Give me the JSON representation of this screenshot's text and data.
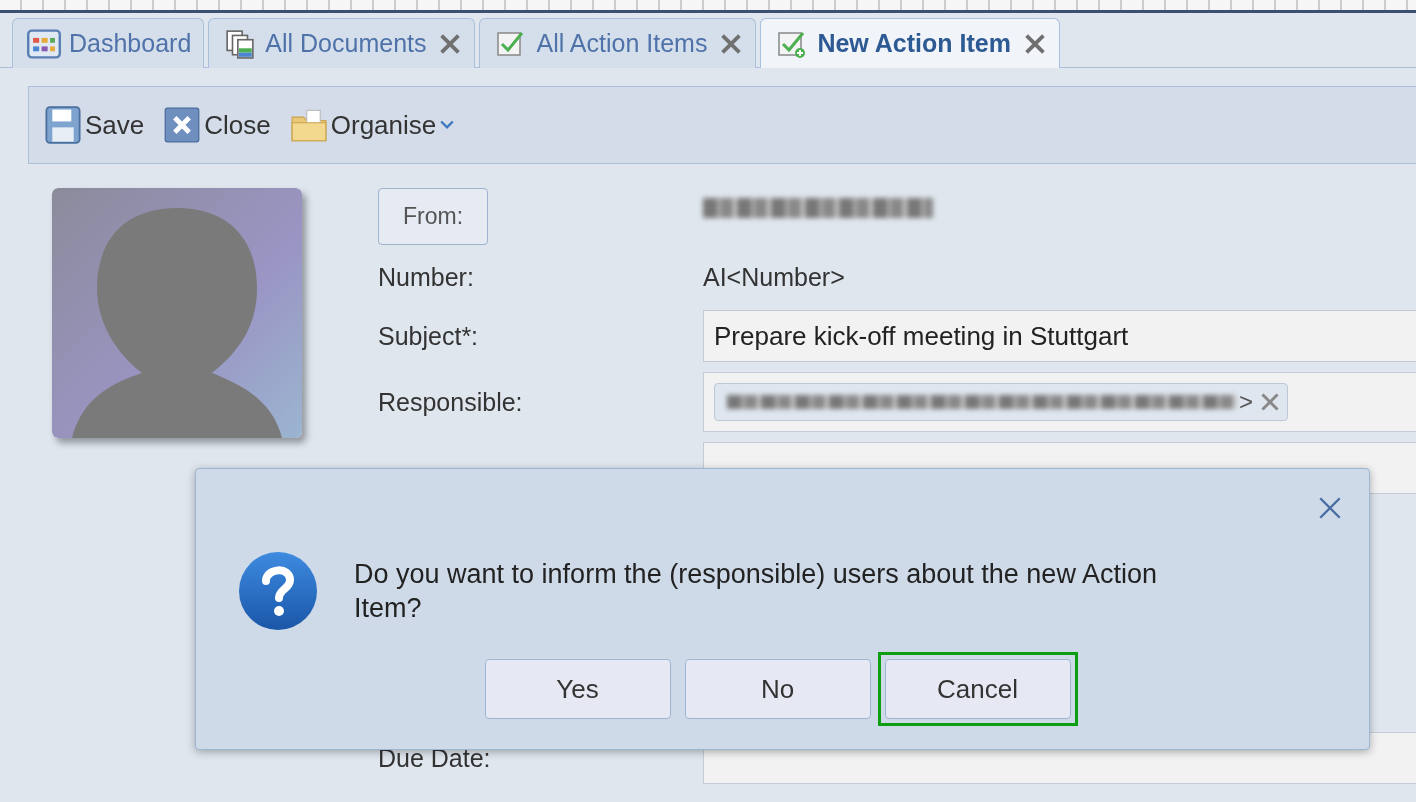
{
  "tabs": [
    {
      "label": "Dashboard",
      "kind": "dashboard",
      "closable": false,
      "selected": false
    },
    {
      "label": "All Documents",
      "kind": "documents",
      "closable": true,
      "selected": false
    },
    {
      "label": "All Action Items",
      "kind": "list",
      "closable": true,
      "selected": false
    },
    {
      "label": "New Action Item",
      "kind": "new",
      "closable": true,
      "selected": true
    }
  ],
  "toolbar": [
    {
      "label": "Save",
      "kind": "save",
      "dropdown": false
    },
    {
      "label": "Close",
      "kind": "close",
      "dropdown": false
    },
    {
      "label": "Organise",
      "kind": "organise",
      "dropdown": true
    }
  ],
  "form": {
    "from_button": "From:",
    "rows": [
      {
        "label": "Number:",
        "kind": "text",
        "value": "AI<Number>"
      },
      {
        "label": "Subject*:",
        "kind": "input",
        "value": "Prepare kick-off meeting in Stuttgart"
      },
      {
        "label": "Responsible:",
        "kind": "chips",
        "chip_suffix": ">"
      },
      {
        "kind": "input",
        "value": ""
      }
    ],
    "due_date_label": "Due Date:"
  },
  "dialog": {
    "message": "Do you want to inform the (responsible) users about the new Action Item?",
    "buttons": [
      {
        "label": "Yes",
        "highlighted": false
      },
      {
        "label": "No",
        "highlighted": false
      },
      {
        "label": "Cancel",
        "highlighted": true
      }
    ]
  }
}
